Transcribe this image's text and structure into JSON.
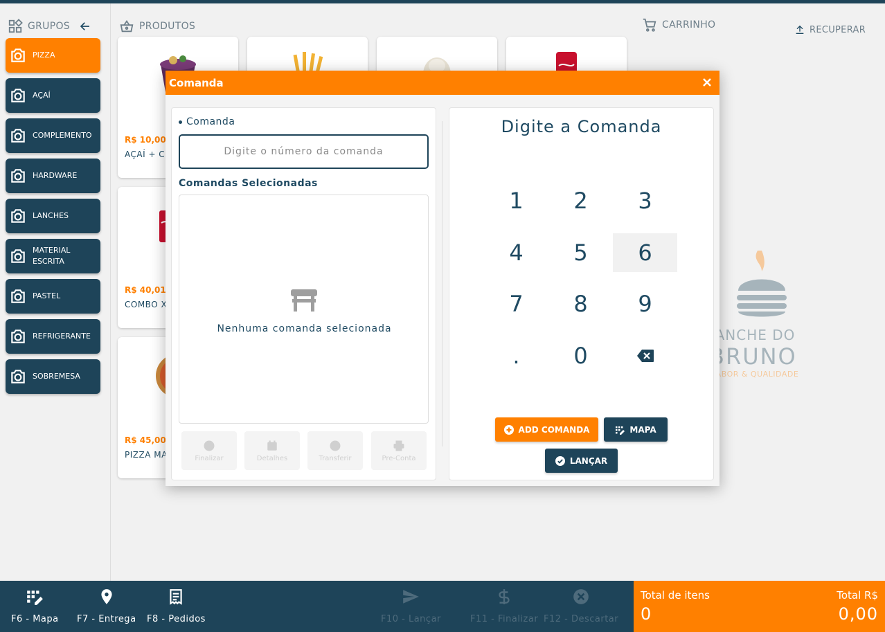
{
  "groups": {
    "title": "GRUPOS",
    "items": [
      {
        "label": "PIZZA"
      },
      {
        "label": "AÇAÍ"
      },
      {
        "label": "COMPLEMENTO"
      },
      {
        "label": "HARDWARE"
      },
      {
        "label": "LANCHES"
      },
      {
        "label": "MATERIAL ESCRITA"
      },
      {
        "label": "PASTEL"
      },
      {
        "label": "REFRIGERANTE"
      },
      {
        "label": "SOBREMESA"
      }
    ]
  },
  "products": {
    "title": "PRODUTOS",
    "items": [
      {
        "price": "R$ 10,00",
        "name": "AÇAÍ + C"
      },
      {
        "price": "R$ 40,01",
        "name": "COMBO X"
      },
      {
        "price": "R$ 45,00",
        "name": "PIZZA MA"
      }
    ]
  },
  "cart": {
    "title": "CARRINHO",
    "recover": "RECUPERAR",
    "logo_line1": "LANCHE DO",
    "logo_line2": "BRUNO",
    "logo_line3": "SABOR & QUALIDADE"
  },
  "modal": {
    "title": "Comanda",
    "comanda_label": "Comanda",
    "comanda_placeholder": "Digite o número da comanda",
    "selected_label": "Comandas Selecionadas",
    "empty_text": "Nenhuma comanda selecionada",
    "actions": [
      {
        "label": "Finalizar"
      },
      {
        "label": "Detalhes"
      },
      {
        "label": "Transferir"
      },
      {
        "label": "Pre-Conta"
      }
    ],
    "keypad_title": "Digite a Comanda",
    "keys": [
      "1",
      "2",
      "3",
      "4",
      "5",
      "6",
      "7",
      "8",
      "9",
      ".",
      "0"
    ],
    "add_button": "ADD COMANDA",
    "map_button": "MAPA",
    "launch_button": "LANÇAR"
  },
  "bottom": {
    "keys": [
      {
        "label": "F6 - Mapa"
      },
      {
        "label": "F7 - Entrega"
      },
      {
        "label": "F8 - Pedidos"
      },
      {
        "label": "F10 - Lançar"
      },
      {
        "label": "F11 - Finalizar"
      },
      {
        "label": "F12 - Descartar"
      }
    ],
    "total_items_label": "Total de itens",
    "total_items_value": "0",
    "total_label": "Total R$",
    "total_value": "0,00"
  },
  "colors": {
    "accent": "#ff8000",
    "navy": "#1e4459"
  }
}
